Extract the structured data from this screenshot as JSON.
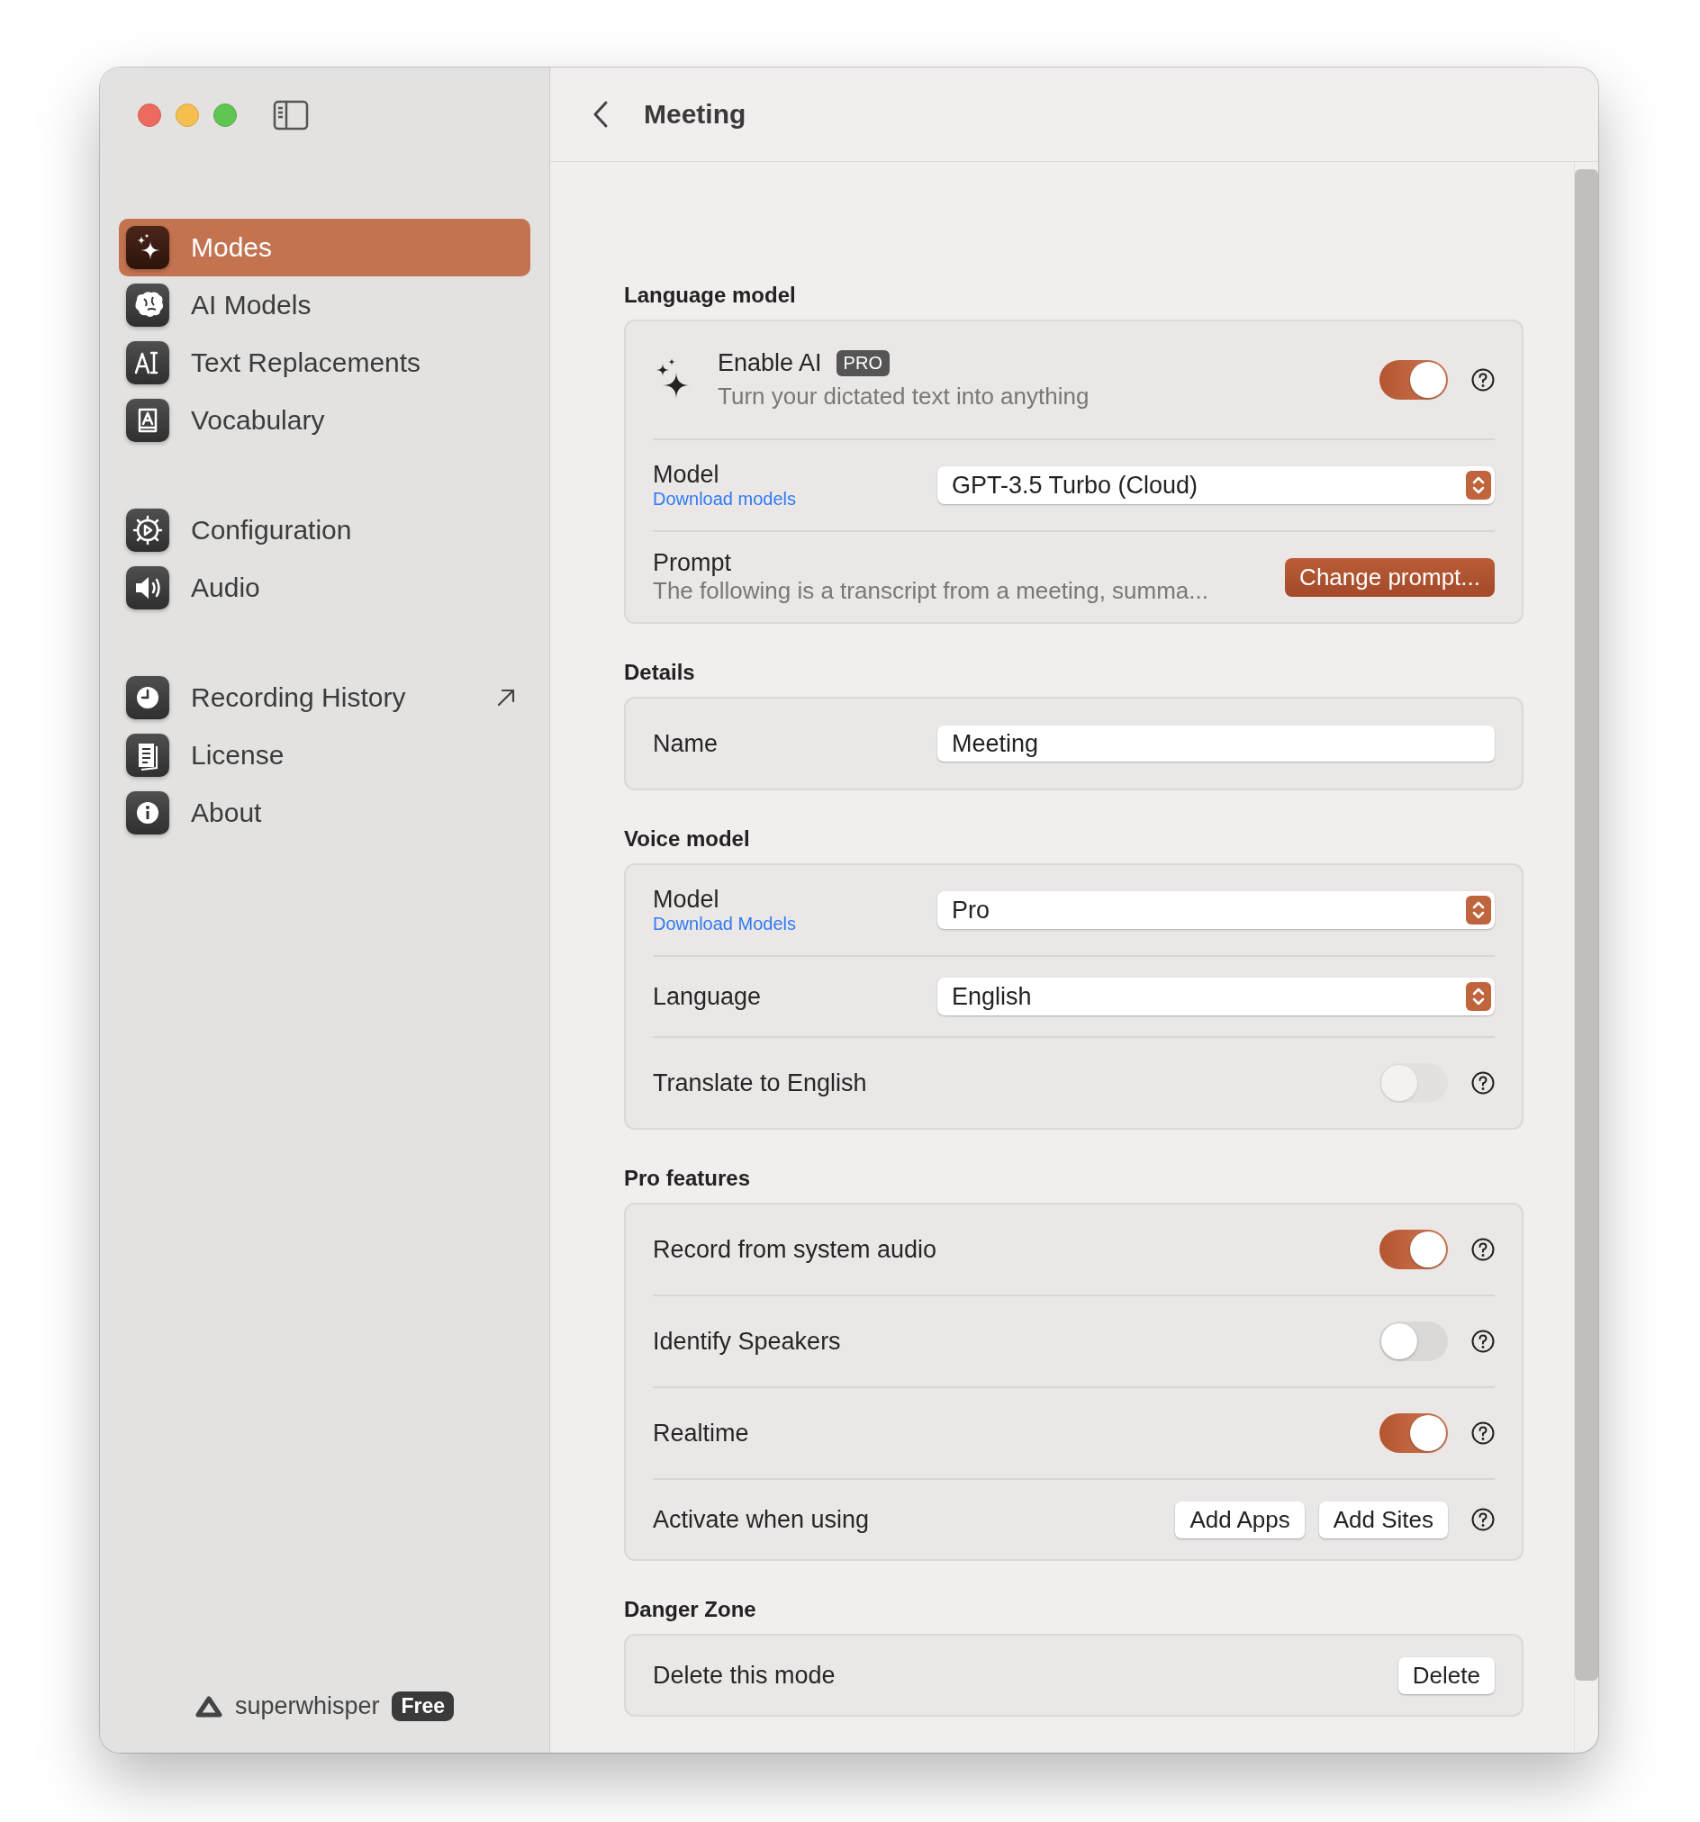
{
  "window": {
    "title": "Meeting"
  },
  "sidebar": {
    "groups": [
      [
        {
          "label": "Modes",
          "selected": true,
          "external": false
        },
        {
          "label": "AI Models",
          "selected": false,
          "external": false
        },
        {
          "label": "Text Replacements",
          "selected": false,
          "external": false
        },
        {
          "label": "Vocabulary",
          "selected": false,
          "external": false
        }
      ],
      [
        {
          "label": "Configuration",
          "selected": false,
          "external": false
        },
        {
          "label": "Audio",
          "selected": false,
          "external": false
        }
      ],
      [
        {
          "label": "Recording History",
          "selected": false,
          "external": true
        },
        {
          "label": "License",
          "selected": false,
          "external": false
        },
        {
          "label": "About",
          "selected": false,
          "external": false
        }
      ]
    ],
    "brand": {
      "name": "superwhisper",
      "badge": "Free"
    }
  },
  "sections": [
    {
      "title": "Language model",
      "rows": [
        {
          "kind": "feature",
          "title": "Enable AI",
          "badge": "PRO",
          "subtitle": "Turn your dictated text into anything",
          "on": true
        },
        {
          "kind": "select",
          "label": "Model",
          "link": "Download models",
          "value": "GPT-3.5 Turbo (Cloud)"
        },
        {
          "kind": "prompt",
          "label": "Prompt",
          "text": "The following is a transcript from a meeting, summa...",
          "button": "Change prompt..."
        }
      ]
    },
    {
      "title": "Details",
      "rows": [
        {
          "kind": "text",
          "label": "Name",
          "value": "Meeting"
        }
      ]
    },
    {
      "title": "Voice model",
      "rows": [
        {
          "kind": "select",
          "label": "Model",
          "link": "Download Models",
          "value": "Pro"
        },
        {
          "kind": "select",
          "label": "Language",
          "value": "English"
        },
        {
          "kind": "toggle",
          "label": "Translate to English",
          "on": false,
          "disabled": true
        }
      ]
    },
    {
      "title": "Pro features",
      "rows": [
        {
          "kind": "toggle",
          "label": "Record from system audio",
          "on": true,
          "disabled": false
        },
        {
          "kind": "toggle",
          "label": "Identify Speakers",
          "on": false,
          "disabled": false
        },
        {
          "kind": "toggle",
          "label": "Realtime",
          "on": true,
          "disabled": false
        },
        {
          "kind": "buttons",
          "label": "Activate when using",
          "buttons": [
            "Add Apps",
            "Add Sites"
          ]
        }
      ]
    },
    {
      "title": "Danger Zone",
      "rows": [
        {
          "kind": "action",
          "label": "Delete this mode",
          "button": "Delete"
        }
      ]
    }
  ]
}
